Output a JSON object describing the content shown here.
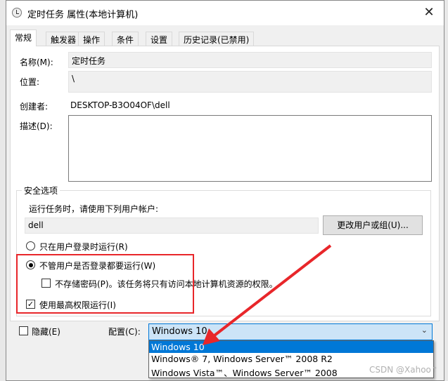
{
  "window": {
    "title": "定时任务 属性(本地计算机)",
    "close": "✕"
  },
  "tabs": [
    {
      "label": "常规"
    },
    {
      "label": "触发器"
    },
    {
      "label": "操作"
    },
    {
      "label": "条件"
    },
    {
      "label": "设置"
    },
    {
      "label": "历史记录(已禁用)"
    }
  ],
  "general": {
    "name_label": "名称(M):",
    "name_value": "定时任务",
    "location_label": "位置:",
    "location_value": "\\",
    "author_label": "创建者:",
    "author_value": "DESKTOP-B3O04OF\\dell",
    "description_label": "描述(D):",
    "description_value": ""
  },
  "security": {
    "group_label": "安全选项",
    "run_as_label": "运行任务时，请使用下列用户帐户:",
    "user_value": "dell",
    "change_user_button": "更改用户或组(U)...",
    "radio_logged_on": "只在用户登录时运行(R)",
    "radio_whether_logged": "不管用户是否登录都要运行(W)",
    "no_store_password": "不存储密码(P)。该任务将只有访问本地计算机资源的权限。",
    "highest_privileges": "使用最高权限运行(I)",
    "selected_radio": "radio_whether_logged",
    "highest_privileges_checked": true,
    "no_store_password_checked": false
  },
  "bottom": {
    "hidden_label": "隐藏(E)",
    "hidden_checked": false,
    "configure_label": "配置(C):",
    "configure_value": "Windows 10",
    "options": [
      "Windows 10",
      "Windows® 7, Windows Server™ 2008 R2",
      "Windows Vista™、Windows Server™ 2008"
    ]
  },
  "watermark": "CSDN @Xahoo↑",
  "colors": {
    "accent": "#0078d7",
    "annotation": "#e8262a"
  }
}
